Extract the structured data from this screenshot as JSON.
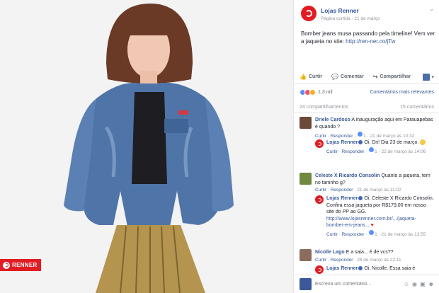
{
  "photo": {
    "brand_badge": "RENNER"
  },
  "post": {
    "page_name": "Lojas Renner",
    "page_label": "Página curtida",
    "date": "21 de março",
    "text": "Bomber jeans musa passando pela timeline! Vem ver a jaqueta no site: ",
    "link": "http://ren-ner.co/jTw"
  },
  "actions": {
    "like": "Curtir",
    "comment": "Comentar",
    "share": "Compartilhar"
  },
  "reactions": {
    "count": "1,3 mil",
    "sort": "Comentários mais relevantes"
  },
  "stats": {
    "shares": "24 compartilhamentos",
    "comments": "15 comentários"
  },
  "comments": [
    {
      "author": "Driele Cardoso",
      "text": "A inauguração aqui em Parauapebas é quando ?",
      "like": "Curtir",
      "reply": "Responder",
      "likes": "1",
      "time": "21 de março às 10:32",
      "reply_item": {
        "author": "Lojas Renner",
        "text": "Oi, Dri! Dia 23 de março.",
        "like": "Curtir",
        "reply": "Responder",
        "likes": "1",
        "time": "22 de março às 14:06"
      }
    },
    {
      "author": "Celeste X Ricardo Consolin",
      "text": "Quanto a jaqueta, tem no tamnho g?",
      "like": "Curtir",
      "reply": "Responder",
      "time": "21 de março às 11:02",
      "reply_item": {
        "author": "Lojas Renner",
        "text": "Oi, Celeste X Ricardo Consolin. Confira essa jaqueta por R$179,00 em nosso site do PP ao GG.",
        "link": "http://www.lojasrenner.com.br/.../jaqueta-bomber-em-jeans...",
        "like": "Curtir",
        "reply": "Responder",
        "likes": "1",
        "time": "21 de março às 13:55"
      }
    },
    {
      "author": "Nicolle Lago",
      "text": "E a saia... é de vcs??",
      "like": "Curtir",
      "reply": "Responder",
      "time": "28 de março às 22:11",
      "reply_item": {
        "author": "Lojas Renner",
        "text": "Oi, Nicolle. Essa saia é"
      }
    }
  ],
  "composer": {
    "placeholder": "Escreva um comentário..."
  },
  "colors": {
    "brand_red": "#e31b23",
    "facebook_blue": "#365899",
    "denim": "#4f74a8"
  }
}
